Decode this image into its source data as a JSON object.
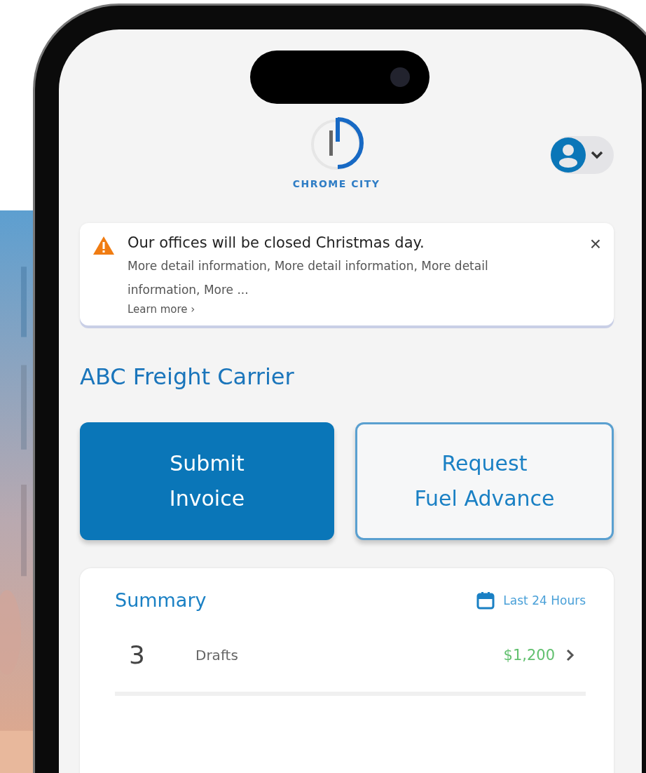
{
  "header": {
    "logo_text": "CHROME CITY"
  },
  "alert": {
    "kind": "warning",
    "title": "Our offices will be closed Christmas day.",
    "detail": "More detail information, More detail information, More detail information, More ...",
    "link": "Learn more ›",
    "close": "×"
  },
  "company": "ABC Freight Carrier",
  "actions": [
    {
      "label": "Submit\nInvoice",
      "kind": "primary"
    },
    {
      "label": "Request\nFuel Advance",
      "kind": "secondary"
    }
  ],
  "summary": {
    "title": "Summary",
    "range": "Last 24 Hours",
    "rows": [
      {
        "count": "3",
        "label": "Drafts",
        "amount": "$1,200"
      }
    ]
  }
}
